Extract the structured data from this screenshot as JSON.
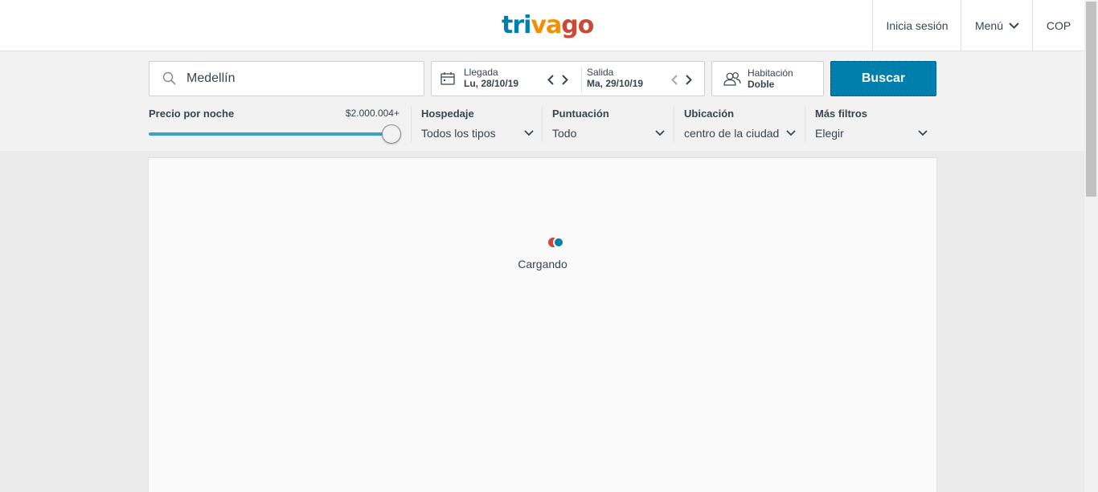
{
  "header": {
    "logo": {
      "part1": "tri",
      "part2": "va",
      "part3": "go"
    },
    "login_label": "Inicia sesión",
    "menu_label": "Menú",
    "currency_label": "COP"
  },
  "search": {
    "destination_value": "Medellín",
    "checkin": {
      "label": "Llegada",
      "value": "Lu, 28/10/19"
    },
    "checkout": {
      "label": "Salida",
      "value": "Ma, 29/10/19"
    },
    "room": {
      "label": "Habitación",
      "value": "Doble"
    },
    "search_button": "Buscar"
  },
  "filters": {
    "price": {
      "title": "Precio por noche",
      "max_label": "$2.000.004+",
      "slider_fraction": 1.0
    },
    "lodging": {
      "title": "Hospedaje",
      "value": "Todos los tipos"
    },
    "rating": {
      "title": "Puntuación",
      "value": "Todo"
    },
    "location": {
      "title": "Ubicación",
      "value": "centro de la ciudad"
    },
    "more": {
      "title": "Más filtros",
      "value": "Elegir"
    }
  },
  "results": {
    "loading_text": "Cargando"
  },
  "colors": {
    "brand_blue": "#007fad",
    "brand_orange": "#f48f00",
    "brand_red": "#c94a38",
    "slider": "#3f9ec4"
  },
  "icons": [
    "search-icon",
    "calendar-icon",
    "chevron-left-icon",
    "chevron-right-icon",
    "users-icon",
    "chevron-down-icon"
  ]
}
